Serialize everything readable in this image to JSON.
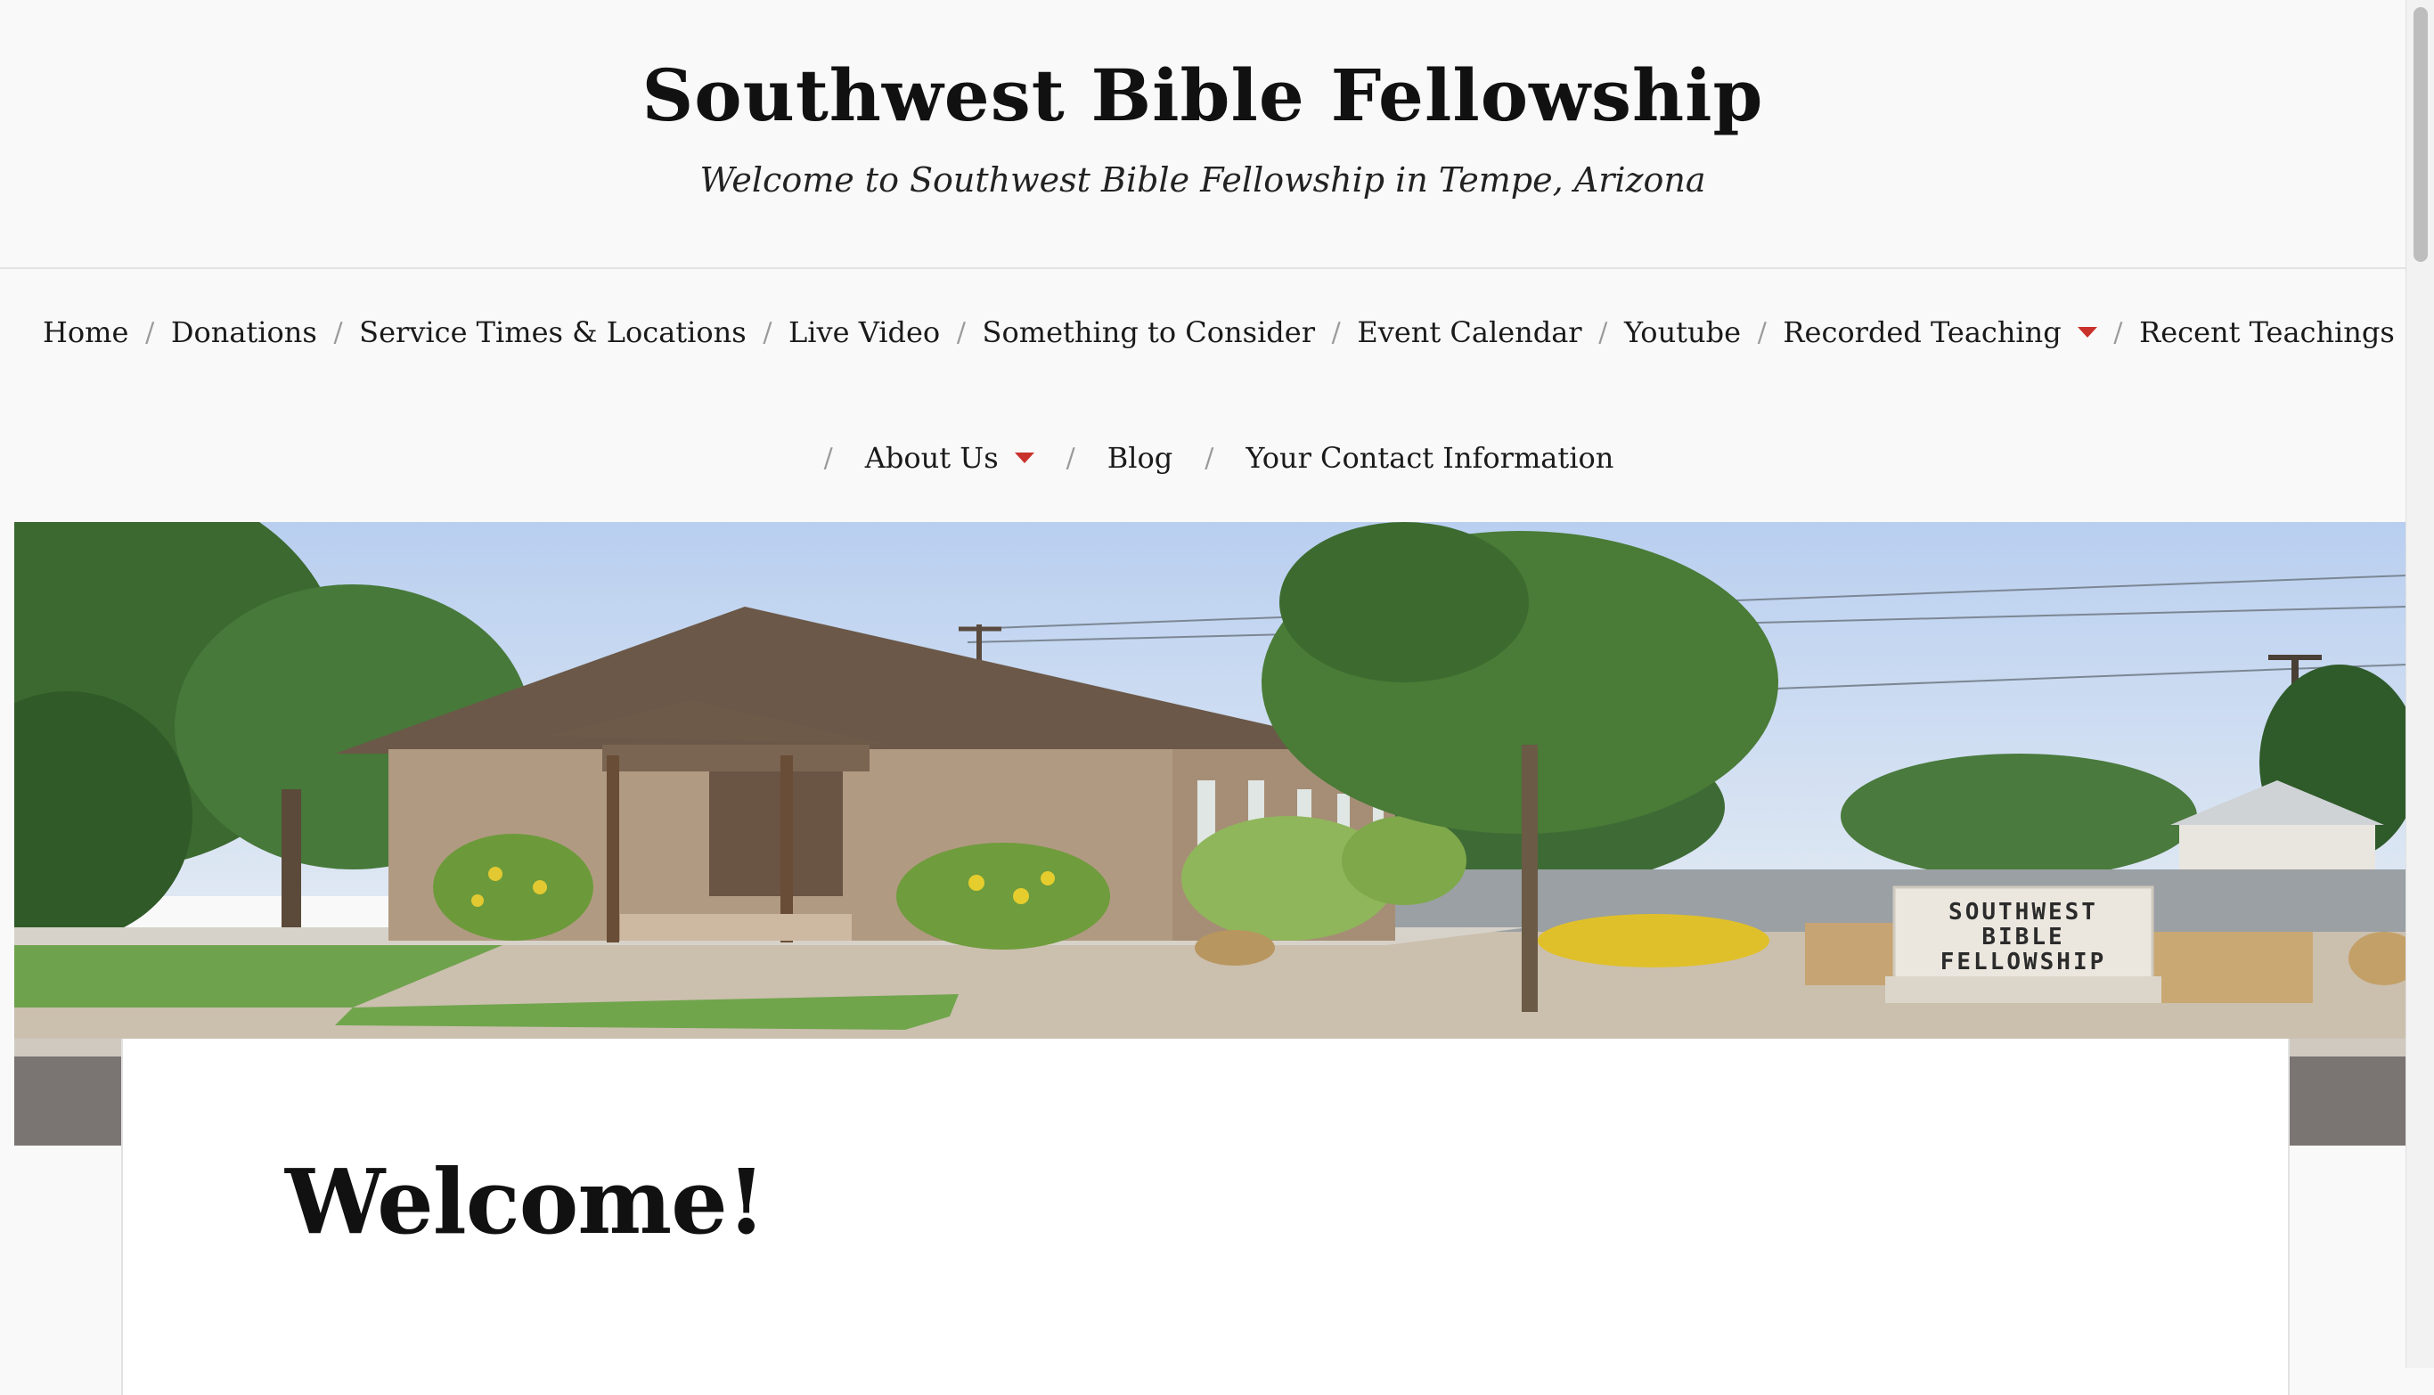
{
  "site": {
    "title": "Southwest Bible Fellowship",
    "tagline": "Welcome to Southwest Bible Fellowship in Tempe, Arizona"
  },
  "nav": {
    "separator": "/",
    "items": [
      {
        "label": "Home"
      },
      {
        "label": "Donations"
      },
      {
        "label": "Service Times & Locations"
      },
      {
        "label": "Live Video"
      },
      {
        "label": "Something to Consider"
      },
      {
        "label": "Event Calendar"
      },
      {
        "label": "Youtube"
      },
      {
        "label": "Recorded Teaching",
        "dropdown": true
      },
      {
        "label": "Recent Teachings"
      },
      {
        "label": "About Us",
        "dropdown": true
      },
      {
        "label": "Blog"
      },
      {
        "label": "Your Contact Information"
      }
    ]
  },
  "hero": {
    "sign_lines": [
      "SOUTHWEST",
      "BIBLE",
      "FELLOWSHIP"
    ]
  },
  "content": {
    "page_title": "Welcome!"
  },
  "colors": {
    "accent": "#c9322b",
    "background": "#f9f9f9",
    "card": "#ffffff",
    "text": "#111111"
  }
}
